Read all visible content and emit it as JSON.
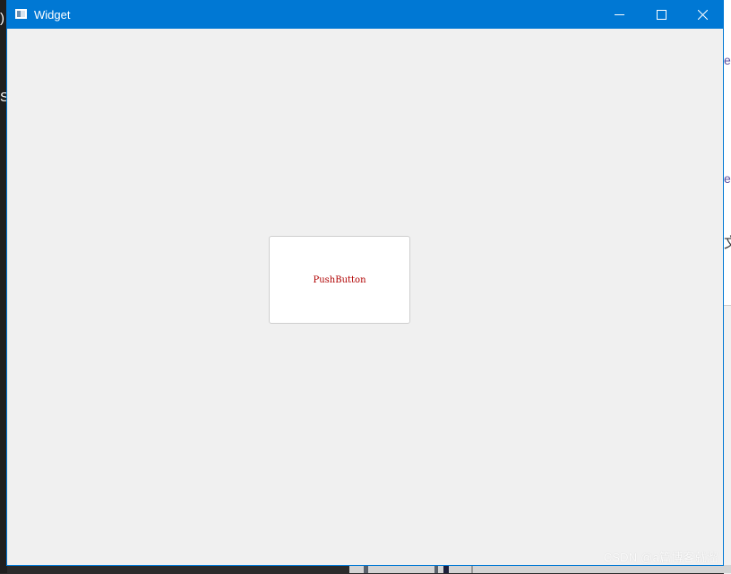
{
  "window": {
    "title": "Widget",
    "icon": "app-window-icon",
    "controls": {
      "minimize": "minimize-icon",
      "maximize": "maximize-icon",
      "close": "close-icon"
    }
  },
  "content": {
    "push_button_label": "PushButton"
  },
  "watermark": "CSDN @a篇博客就溜",
  "background_fragments": {
    "left": [
      ")",
      "S"
    ],
    "right": [
      "e",
      "e",
      "文"
    ]
  },
  "colors": {
    "titlebar": "#0078d4",
    "client_background": "#f0f0f0",
    "button_background": "#ffffff",
    "button_text": "#b00000"
  }
}
